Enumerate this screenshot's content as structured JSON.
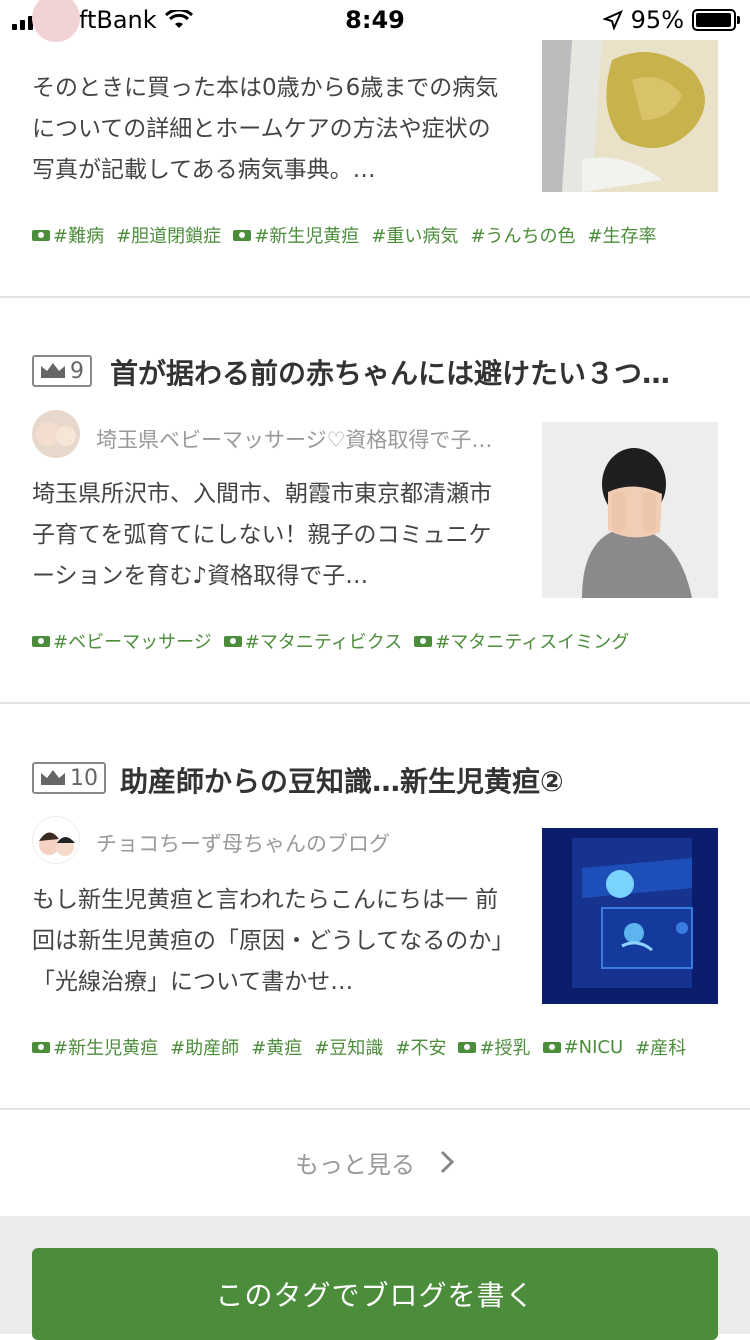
{
  "status_bar": {
    "carrier": "SoftBank",
    "time": "8:49",
    "battery": "95%"
  },
  "posts": [
    {
      "excerpt": "そのときに買った本は0歳から6歳までの病気についての詳細とホームケアの方法や症状の写真が記載してある病気事典。…",
      "tags": [
        {
          "label": "#難病",
          "official": true
        },
        {
          "label": "#胆道閉鎖症",
          "official": false
        },
        {
          "label": "#新生児黄疸",
          "official": true
        },
        {
          "label": "#重い病気",
          "official": false
        },
        {
          "label": "#うんちの色",
          "official": false
        },
        {
          "label": "#生存率",
          "official": false
        }
      ]
    },
    {
      "rank": "9",
      "title": "首が据わる前の赤ちゃんには避けたい３つ…",
      "author": "埼玉県ベビーマッサージ♡資格取得で子…",
      "excerpt": "埼玉県所沢市、入間市、朝霞市東京都清瀬市 子育てを弧育てにしない！親子のコミュニケーションを育む♪資格取得で子…",
      "tags": [
        {
          "label": "#ベビーマッサージ",
          "official": true
        },
        {
          "label": "#マタニティビクス",
          "official": true
        },
        {
          "label": "#マタニティスイミング",
          "official": true
        }
      ]
    },
    {
      "rank": "10",
      "title": "助産師からの豆知識…新生児黄疸②",
      "author": "チョコちーず母ちゃんのブログ",
      "excerpt": "もし新生児黄疸と言われたらこんにちは一 前回は新生児黄疸の「原因・どうしてなるのか」「光線治療」について書かせ…",
      "tags": [
        {
          "label": "#新生児黄疸",
          "official": true
        },
        {
          "label": "#助産師",
          "official": false
        },
        {
          "label": "#黄疸",
          "official": false
        },
        {
          "label": "#豆知識",
          "official": false
        },
        {
          "label": "#不安",
          "official": false
        },
        {
          "label": "#授乳",
          "official": true
        },
        {
          "label": "#NICU",
          "official": true
        },
        {
          "label": "#産科",
          "official": false
        }
      ]
    }
  ],
  "more_label": "もっと見る",
  "cta_label": "このタグでブログを書く",
  "colors": {
    "accent": "#4b8d3a",
    "tag": "#4b8d3a",
    "separator": "#e3e3e3"
  }
}
